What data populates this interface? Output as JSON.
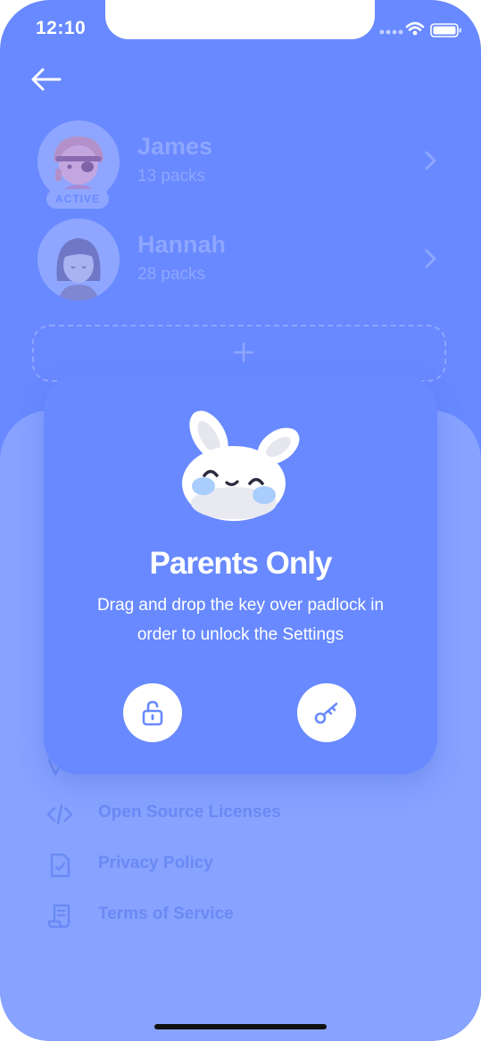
{
  "status_bar": {
    "time": "12:10"
  },
  "profiles": [
    {
      "name": "James",
      "packs": "13 packs",
      "badge": "ACTIVE"
    },
    {
      "name": "Hannah",
      "packs": "28 packs"
    }
  ],
  "modal": {
    "title": "Parents Only",
    "line1": "Drag and drop the key over padlock in",
    "line2": "order to unlock the Settings"
  },
  "menu": [
    {
      "label": "Open Source Licenses",
      "icon": "code-icon"
    },
    {
      "label": "Privacy Policy",
      "icon": "document-check-icon"
    },
    {
      "label": "Terms of Service",
      "icon": "scroll-icon"
    }
  ],
  "colors": {
    "background": "#6889ff",
    "sheet": "#87a2ff",
    "accent": "#ffffff"
  }
}
